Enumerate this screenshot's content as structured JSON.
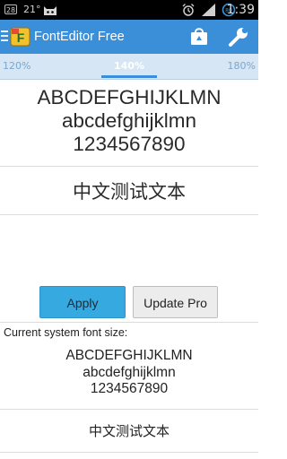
{
  "status_bar": {
    "notification_badge": "28",
    "temperature": "21°",
    "icons": [
      "cat-icon",
      "alarm-icon",
      "signal-icon",
      "battery-icon"
    ],
    "time": "1:39"
  },
  "action_bar": {
    "title": "FontEditor Free",
    "logo_text": "F",
    "color": "#3b8ed8"
  },
  "tabs": [
    {
      "label": "120%",
      "selected": false
    },
    {
      "label": "140%",
      "selected": true
    },
    {
      "label": "180%",
      "selected": false
    }
  ],
  "preview": {
    "uppercase": "ABCDEFGHIJKLMN",
    "lowercase": "abcdefghijklmn",
    "digits": "1234567890",
    "chinese": "中文测试文本"
  },
  "buttons": {
    "apply": "Apply",
    "update_pro": "Update Pro"
  },
  "current": {
    "label": "Current system font size:",
    "uppercase": "ABCDEFGHIJKLMN",
    "lowercase": "abcdefghijklmn",
    "digits": "1234567890",
    "chinese": "中文测试文本"
  }
}
